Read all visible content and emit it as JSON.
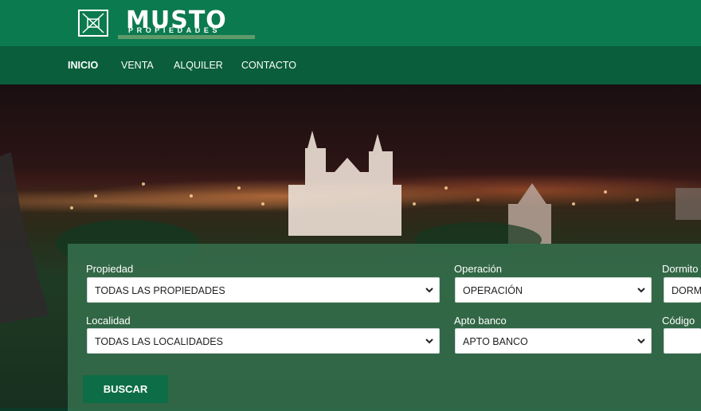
{
  "brand": {
    "name": "MUSTO",
    "tagline": "PROPIEDADES"
  },
  "nav": {
    "items": [
      "INICIO",
      "VENTA",
      "ALQUILER",
      "CONTACTO"
    ],
    "active": "INICIO"
  },
  "search": {
    "fields": {
      "propiedad": {
        "label": "Propiedad",
        "value": "TODAS LAS PROPIEDADES"
      },
      "operacion": {
        "label": "Operación",
        "value": "OPERACIÓN"
      },
      "dormitorios": {
        "label": "Dormito",
        "value": "DORM"
      },
      "localidad": {
        "label": "Localidad",
        "value": "TODAS LAS LOCALIDADES"
      },
      "apto_banco": {
        "label": "Apto banco",
        "value": "APTO BANCO"
      },
      "codigo": {
        "label": "Código",
        "value": ""
      }
    },
    "button_label": "BUSCAR"
  },
  "colors": {
    "topbar": "#0c7a4f",
    "navbar": "#0a5e3c",
    "button": "#0d6d46"
  },
  "icons": [
    "logo-mark-icon",
    "chevron-down-icon"
  ]
}
